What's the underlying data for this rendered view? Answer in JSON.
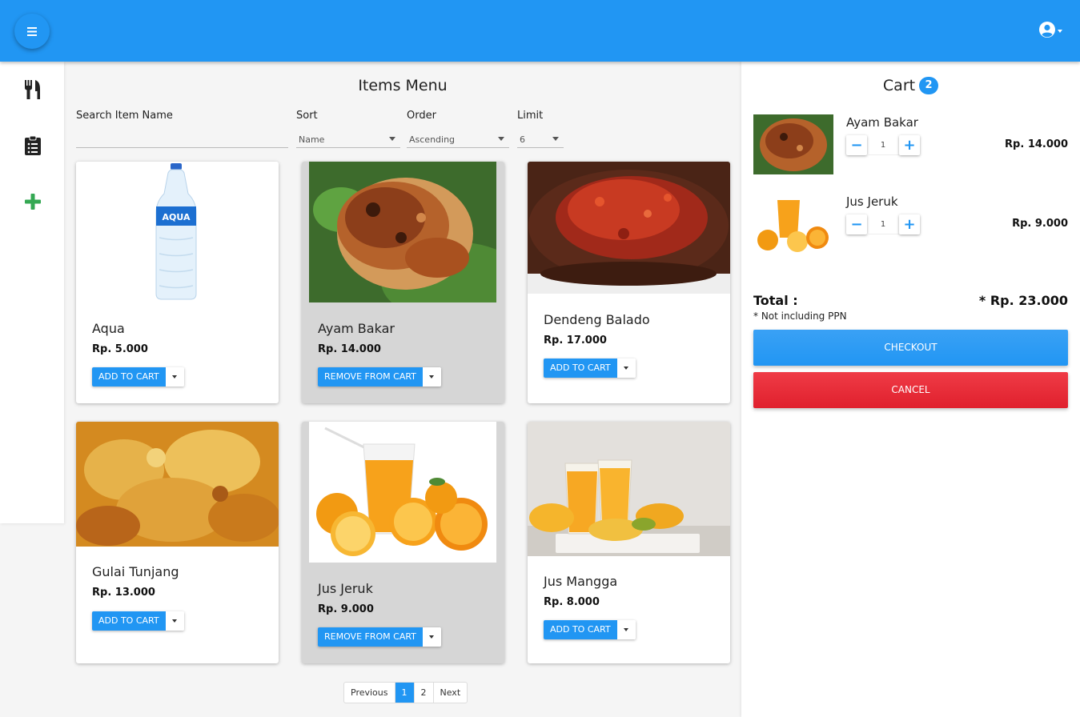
{
  "icons": {
    "menu": "hamburger-icon",
    "account": "user-circle-icon",
    "sidebar": [
      "utensils-icon",
      "clipboard-list-icon",
      "plus-icon"
    ]
  },
  "colors": {
    "primary": "#2196f3",
    "danger": "#e0202d",
    "add": "#34a853"
  },
  "menu": {
    "title": "Items Menu",
    "filters": {
      "search_label": "Search Item Name",
      "sort_label": "Sort",
      "sort_value": "Name",
      "order_label": "Order",
      "order_value": "Ascending",
      "limit_label": "Limit",
      "limit_value": "6"
    },
    "items": [
      {
        "name": "Aqua",
        "price": "Rp. 5.000",
        "action": "ADD TO CART"
      },
      {
        "name": "Ayam Bakar",
        "price": "Rp. 14.000",
        "action": "REMOVE FROM CART"
      },
      {
        "name": "Dendeng Balado",
        "price": "Rp. 17.000",
        "action": "ADD TO CART"
      },
      {
        "name": "Gulai Tunjang",
        "price": "Rp. 13.000",
        "action": "ADD TO CART"
      },
      {
        "name": "Jus Jeruk",
        "price": "Rp. 9.000",
        "action": "REMOVE FROM CART"
      },
      {
        "name": "Jus Mangga",
        "price": "Rp. 8.000",
        "action": "ADD TO CART"
      }
    ],
    "pagination": {
      "previous": "Previous",
      "pages": [
        "1",
        "2"
      ],
      "current": "1",
      "next": "Next"
    }
  },
  "cart": {
    "title": "Cart",
    "count": "2",
    "items": [
      {
        "name": "Ayam Bakar",
        "qty": "1",
        "price": "Rp. 14.000"
      },
      {
        "name": "Jus Jeruk",
        "qty": "1",
        "price": "Rp. 9.000"
      }
    ],
    "qty_minus": "−",
    "qty_plus": "+",
    "total_label": "Total :",
    "total_value": "* Rp. 23.000",
    "note": "* Not including PPN",
    "checkout": "CHECKOUT",
    "cancel": "CANCEL"
  }
}
